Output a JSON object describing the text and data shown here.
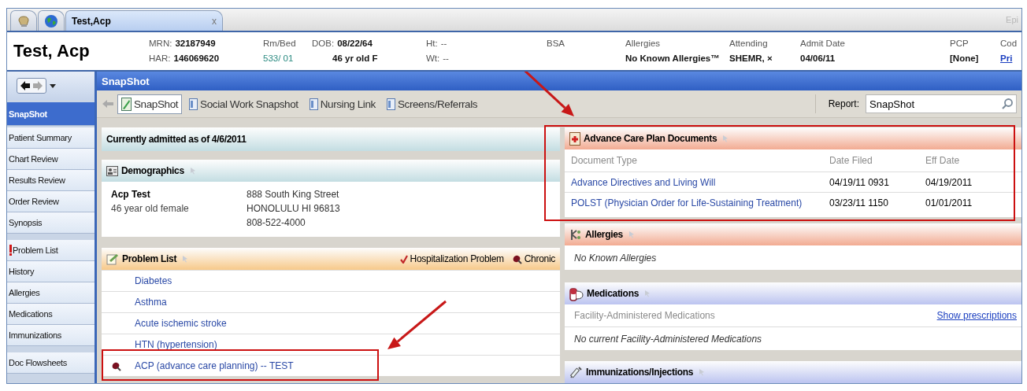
{
  "window_tabs": [
    {
      "kind": "app",
      "selected": false
    },
    {
      "kind": "globe",
      "selected": false
    },
    {
      "kind": "patient",
      "label": "Test,Acp",
      "close": "x",
      "selected": true
    }
  ],
  "brand": "Epi",
  "patient_header": {
    "name": "Test, Acp",
    "columns": [
      {
        "lines": [
          {
            "label": "MRN:",
            "value": "32187949"
          },
          {
            "label": "HAR:",
            "value": "146069620"
          }
        ]
      },
      {
        "lines": [
          {
            "label": "Rm/Bed"
          },
          {
            "value": "533/ 01",
            "kind": "location"
          }
        ]
      },
      {
        "lines": [
          {
            "label": "DOB:",
            "value": "08/22/64"
          },
          {
            "value": "46 yr old F",
            "kind": "indented"
          }
        ]
      },
      {
        "lines": [
          {
            "label": "Ht:",
            "value": "--",
            "kind": "plain"
          },
          {
            "label": "Wt:",
            "value": "--",
            "kind": "plain"
          }
        ]
      },
      {
        "lines": [
          {
            "label": "BSA"
          }
        ]
      },
      {
        "lines": [
          {
            "label": "Allergies"
          },
          {
            "value": "No Known Allergies™"
          }
        ]
      },
      {
        "lines": [
          {
            "label": "Attending"
          },
          {
            "value": "SHEMR, ×"
          }
        ]
      },
      {
        "lines": [
          {
            "label": "Admit Date"
          },
          {
            "value": "04/06/11"
          }
        ]
      },
      {
        "lines": [
          {
            "label": "PCP"
          },
          {
            "value": "[None]"
          }
        ]
      },
      {
        "lines": [
          {
            "label": "Cod"
          },
          {
            "value": "Pri",
            "kind": "link"
          }
        ]
      }
    ]
  },
  "sidebar": {
    "groups": [
      [
        {
          "label": "SnapShot",
          "selected": true,
          "alert": false
        },
        {
          "label": "Patient Summary",
          "selected": false,
          "alert": false
        },
        {
          "label": "Chart Review",
          "selected": false,
          "alert": false
        },
        {
          "label": "Results Review",
          "selected": false,
          "alert": false
        },
        {
          "label": "Order Review",
          "selected": false,
          "alert": false
        },
        {
          "label": "Synopsis",
          "selected": false,
          "alert": false
        }
      ],
      [
        {
          "label": "Problem List",
          "selected": false,
          "alert": true
        },
        {
          "label": "History",
          "selected": false,
          "alert": false
        },
        {
          "label": "Allergies",
          "selected": false,
          "alert": false
        },
        {
          "label": "Medications",
          "selected": false,
          "alert": false
        },
        {
          "label": "Immunizations",
          "selected": false,
          "alert": false
        }
      ],
      [
        {
          "label": "Doc Flowsheets",
          "selected": false,
          "alert": false
        }
      ]
    ]
  },
  "title": "SnapShot",
  "toolbar": {
    "tabs": [
      {
        "label": "SnapShot",
        "selected": true
      },
      {
        "label": "Social Work Snapshot",
        "selected": false
      },
      {
        "label": "Nursing Link",
        "selected": false
      },
      {
        "label": "Screens/Referrals",
        "selected": false
      }
    ],
    "report_label": "Report:",
    "report_value": "SnapShot"
  },
  "left_column": [
    {
      "kind": "banner",
      "title": "Currently admitted as of 4/6/2011",
      "color": "#c3dde2"
    },
    {
      "kind": "demographics",
      "title": "Demographics",
      "color": "#c3dde2",
      "name": "Acp Test",
      "description": "46 year old female",
      "address": [
        "888 South King Street",
        "HONOLULU HI 96813",
        "808-522-4000"
      ]
    },
    {
      "kind": "problems",
      "title": "Problem List",
      "color": "#f7c98a",
      "legend": [
        {
          "label": "Hospitalization Problem",
          "kind": "hospital"
        },
        {
          "label": "Chronic",
          "kind": "chronic"
        }
      ],
      "rows": [
        {
          "label": "Diabetes",
          "chronic": false,
          "highlighted": false
        },
        {
          "label": "Asthma",
          "chronic": false,
          "highlighted": false
        },
        {
          "label": "Acute ischemic stroke",
          "chronic": false,
          "highlighted": false
        },
        {
          "label": "HTN (hypertension)",
          "chronic": false,
          "highlighted": false
        },
        {
          "label": "ACP (advance care planning) -- TEST",
          "chronic": true,
          "highlighted": true
        }
      ]
    }
  ],
  "right_column": [
    {
      "kind": "documents",
      "title": "Advance Care Plan Documents",
      "color": "#f2ab92",
      "highlighted": true,
      "columns": [
        "Document Type",
        "Date Filed",
        "Eff Date"
      ],
      "rows": [
        [
          "Advance Directives and Living Will",
          "04/19/11 0931",
          "04/19/2011"
        ],
        [
          "POLST (Physician Order for Life-Sustaining Treatment)",
          "03/23/11 1150",
          "01/01/2011"
        ]
      ]
    },
    {
      "kind": "allergies",
      "title": "Allergies",
      "color": "#f2ab92",
      "note": "No Known Allergies"
    },
    {
      "kind": "medications",
      "title": "Medications",
      "color": "#bcc4f0",
      "subheader": "Facility-Administered Medications",
      "link": "Show prescriptions",
      "note": "No current Facility-Administered Medications"
    },
    {
      "kind": "immunizations",
      "title": "Immunizations/Injections",
      "color": "#bcc4f0"
    }
  ]
}
